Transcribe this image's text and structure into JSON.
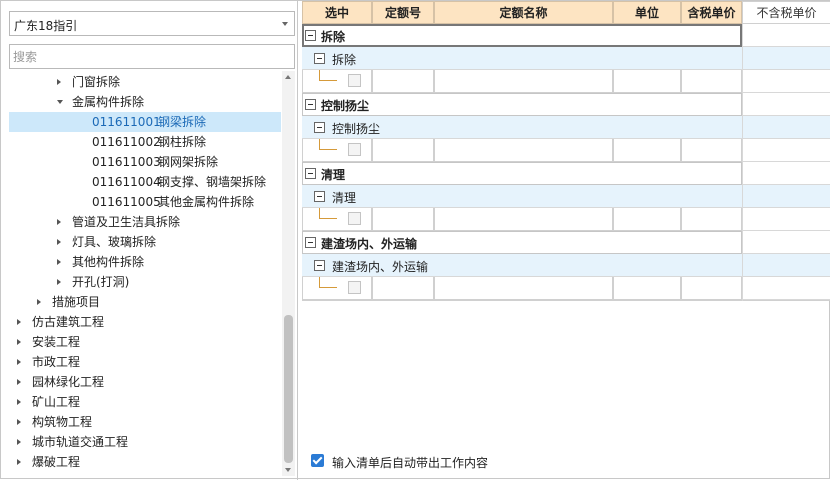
{
  "left": {
    "combo_value": "广东18指引",
    "search_placeholder": "搜索",
    "tree": [
      {
        "label": "门窗拆除",
        "level": 2,
        "toggle": "collapsed"
      },
      {
        "label": "金属构件拆除",
        "level": 2,
        "toggle": "expanded"
      },
      {
        "code": "011611001",
        "label": "钢梁拆除",
        "level": 3,
        "selected": true
      },
      {
        "code": "011611002",
        "label": "钢柱拆除",
        "level": 3
      },
      {
        "code": "011611003",
        "label": "钢网架拆除",
        "level": 3
      },
      {
        "code": "011611004",
        "label": "钢支撑、钢墙架拆除",
        "level": 3
      },
      {
        "code": "011611005",
        "label": "其他金属构件拆除",
        "level": 3
      },
      {
        "label": "管道及卫生洁具拆除",
        "level": 2,
        "toggle": "collapsed"
      },
      {
        "label": "灯具、玻璃拆除",
        "level": 2,
        "toggle": "collapsed"
      },
      {
        "label": "其他构件拆除",
        "level": 2,
        "toggle": "collapsed"
      },
      {
        "label": "开孔(打洞)",
        "level": 2,
        "toggle": "collapsed"
      },
      {
        "label": "措施项目",
        "level": 1,
        "toggle": "collapsed"
      },
      {
        "label": "仿古建筑工程",
        "level": 0,
        "toggle": "collapsed"
      },
      {
        "label": "安装工程",
        "level": 0,
        "toggle": "collapsed"
      },
      {
        "label": "市政工程",
        "level": 0,
        "toggle": "collapsed"
      },
      {
        "label": "园林绿化工程",
        "level": 0,
        "toggle": "collapsed"
      },
      {
        "label": "矿山工程",
        "level": 0,
        "toggle": "collapsed"
      },
      {
        "label": "构筑物工程",
        "level": 0,
        "toggle": "collapsed"
      },
      {
        "label": "城市轨道交通工程",
        "level": 0,
        "toggle": "collapsed"
      },
      {
        "label": "爆破工程",
        "level": 0,
        "toggle": "collapsed"
      }
    ]
  },
  "grid": {
    "headers": [
      "选中",
      "定额号",
      "定额名称",
      "单位",
      "含税单价",
      "不含税单价"
    ],
    "groups": [
      {
        "title": "拆除",
        "sub": "拆除"
      },
      {
        "title": "控制扬尘",
        "sub": "控制扬尘"
      },
      {
        "title": "清理",
        "sub": "清理"
      },
      {
        "title": "建渣场内、外运输",
        "sub": "建渣场内、外运输"
      }
    ]
  },
  "bottom": {
    "checkbox_label": "输入清单后自动带出工作内容",
    "checked": true
  }
}
